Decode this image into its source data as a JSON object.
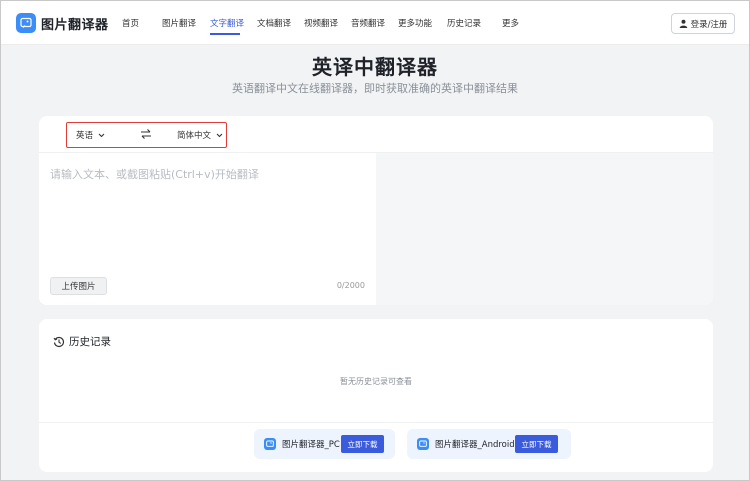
{
  "nav": {
    "logo": "图片翻译器",
    "items": [
      {
        "label": "首页"
      },
      {
        "label": "图片翻译"
      },
      {
        "label": "文字翻译",
        "active": true
      },
      {
        "label": "文档翻译"
      },
      {
        "label": "视频翻译"
      },
      {
        "label": "音频翻译"
      },
      {
        "label": "更多功能"
      },
      {
        "label": "历史记录"
      },
      {
        "label": "更多"
      }
    ],
    "login": "登录/注册"
  },
  "hero": {
    "title": "英译中翻译器",
    "subtitle": "英语翻译中文在线翻译器，即时获取准确的英译中翻译结果"
  },
  "translator": {
    "source_lang": "英语",
    "target_lang": "简体中文",
    "placeholder": "请输入文本、或截图粘贴(Ctrl+v)开始翻译",
    "upload_label": "上传图片",
    "counter": "0/2000"
  },
  "history": {
    "title": "历史记录",
    "empty": "暂无历史记录可查看"
  },
  "downloads": [
    {
      "name": "图片翻译器_PC",
      "button": "立即下载"
    },
    {
      "name": "图片翻译器_Android",
      "button": "立即下载"
    }
  ],
  "colors": {
    "accent": "#3a5bdc",
    "logo_blue": "#3b8df8",
    "highlight_red": "#e03c3c",
    "page_bg": "#f2f3f5"
  },
  "icons": {
    "logo": "image-translate-icon",
    "login": "user-icon",
    "swap": "swap-arrows-icon",
    "dropdown": "chevron-down-icon",
    "history": "history-clock-icon"
  }
}
